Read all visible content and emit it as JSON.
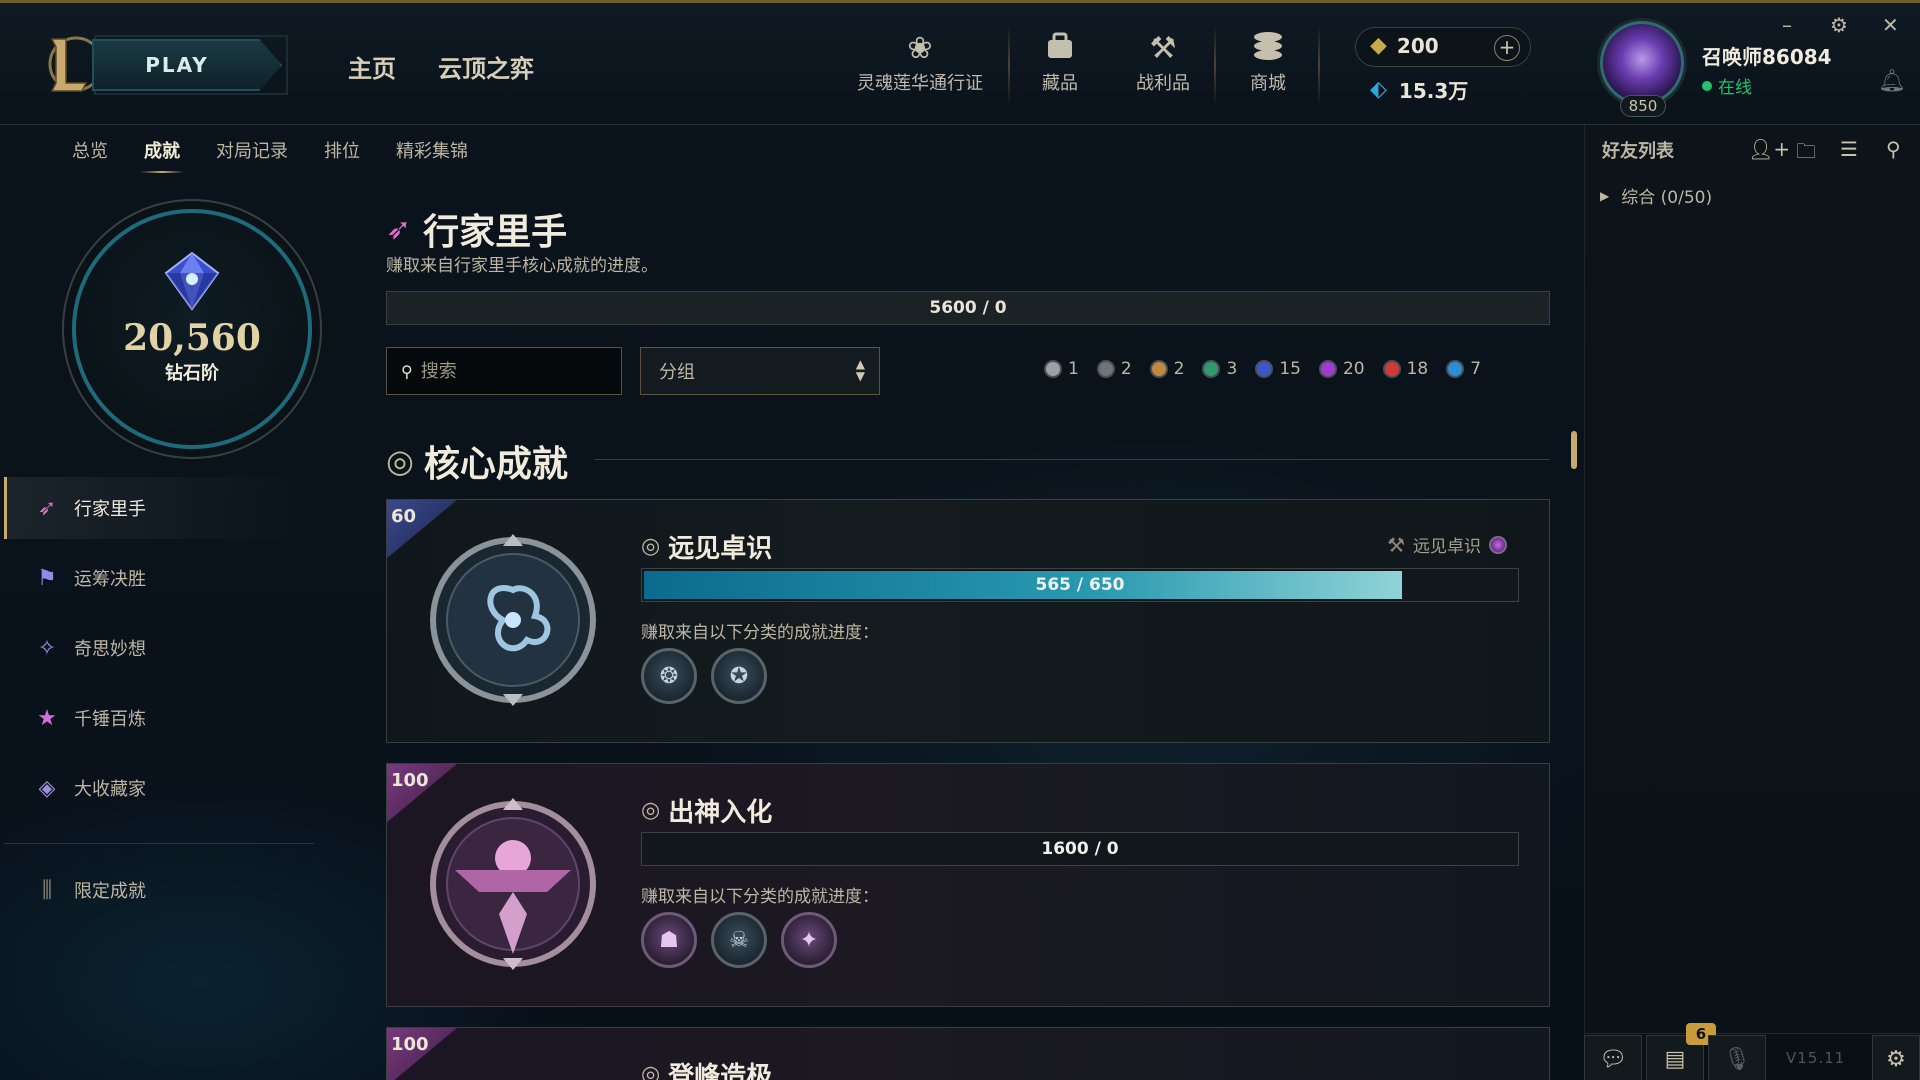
{
  "header": {
    "play_label": "PLAY",
    "nav": [
      "主页",
      "云顶之弈"
    ],
    "icons": [
      {
        "label": "灵魂莲华通行证",
        "icon": "lotus-icon"
      },
      {
        "label": "藏品",
        "icon": "collection-icon"
      },
      {
        "label": "战利品",
        "icon": "loot-icon"
      },
      {
        "label": "商城",
        "icon": "store-icon"
      }
    ],
    "rp": "200",
    "be": "15.3万",
    "summoner_name": "召唤师86084",
    "status": "在线",
    "level": "850",
    "status_color": "#1fc46b"
  },
  "subnav": [
    "总览",
    "成就",
    "对局记录",
    "排位",
    "精彩集锦"
  ],
  "profile": {
    "points": "20,560",
    "rank": "钻石阶"
  },
  "sidebar": {
    "items": [
      {
        "label": "行家里手",
        "icon": "feather-icon"
      },
      {
        "label": "运筹决胜",
        "icon": "banner-icon"
      },
      {
        "label": "奇思妙想",
        "icon": "star-swirl-icon"
      },
      {
        "label": "千锤百炼",
        "icon": "star-icon"
      },
      {
        "label": "大收藏家",
        "icon": "stack-icon"
      }
    ],
    "limited": {
      "label": "限定成就",
      "icon": "legacy-icon"
    }
  },
  "main": {
    "title": "行家里手",
    "subtitle": "赚取来自行家里手核心成就的进度。",
    "progress": "5600 / 0",
    "search_placeholder": "搜索",
    "group_label": "分组",
    "tiers": [
      {
        "count": "1",
        "color": "#9aa0a3"
      },
      {
        "count": "2",
        "color": "#6e7478"
      },
      {
        "count": "2",
        "color": "#c08a3e"
      },
      {
        "count": "3",
        "color": "#2f9a6e"
      },
      {
        "count": "15",
        "color": "#3a56c9"
      },
      {
        "count": "20",
        "color": "#a23ad1"
      },
      {
        "count": "18",
        "color": "#d23a3a"
      },
      {
        "count": "7",
        "color": "#2a8fd8"
      }
    ],
    "section_title": "核心成就",
    "cards": [
      {
        "badge": "60",
        "title": "远见卓识",
        "reward": "远见卓识",
        "progress": "565 / 650",
        "fill_ratio": 0.87,
        "desc": "赚取来自以下分类的成就进度："
      },
      {
        "badge": "100",
        "title": "出神入化",
        "progress": "1600 / 0",
        "desc": "赚取来自以下分类的成就进度："
      },
      {
        "badge": "100",
        "title": "登峰造极"
      }
    ]
  },
  "social": {
    "title": "好友列表",
    "group": "综合 (0/50)",
    "badge": "6",
    "version": "V15.11"
  }
}
